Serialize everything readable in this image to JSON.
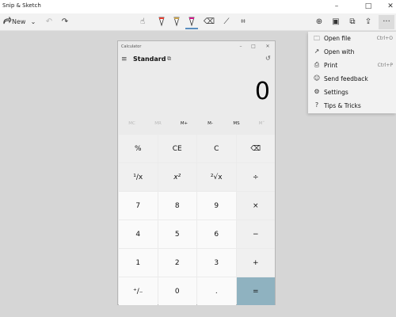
{
  "window": {
    "title": "Snip & Sketch",
    "minimize": "–",
    "maximize": "□",
    "close": "✕"
  },
  "toolbar": {
    "new_label": "New",
    "more_label": "···"
  },
  "calculator": {
    "title": "Calculator",
    "mode": "Standard",
    "display": "0",
    "memory": [
      "MC",
      "MR",
      "M+",
      "M-",
      "MS",
      "M˅"
    ],
    "keys": [
      [
        "%",
        "CE",
        "C",
        "⌫"
      ],
      [
        "¹∕x",
        "x²",
        "²√x",
        "÷"
      ],
      [
        "7",
        "8",
        "9",
        "×"
      ],
      [
        "4",
        "5",
        "6",
        "−"
      ],
      [
        "1",
        "2",
        "3",
        "+"
      ],
      [
        "⁺∕₋",
        "0",
        ".",
        "="
      ]
    ]
  },
  "menu": {
    "items": [
      {
        "label": "Open file",
        "shortcut": "Ctrl+O"
      },
      {
        "label": "Open with",
        "shortcut": ""
      },
      {
        "label": "Print",
        "shortcut": "Ctrl+P"
      },
      {
        "label": "Send feedback",
        "shortcut": ""
      },
      {
        "label": "Settings",
        "shortcut": ""
      },
      {
        "label": "Tips & Tricks",
        "shortcut": ""
      }
    ]
  }
}
